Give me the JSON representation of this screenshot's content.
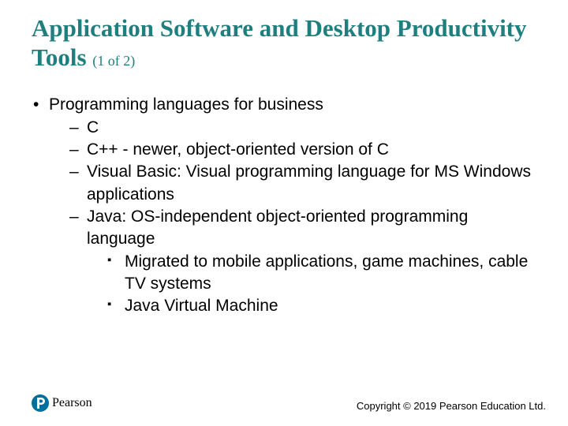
{
  "title": {
    "main": "Application Software and Desktop Productivity Tools",
    "counter": "(1 of 2)"
  },
  "body": {
    "heading": "Programming languages for business",
    "items": [
      {
        "text": "C"
      },
      {
        "text": "C++ - newer, object-oriented version of C"
      },
      {
        "text": "Visual Basic: Visual programming language for MS Windows applications"
      },
      {
        "text": "Java: OS-independent object-oriented programming language",
        "sub": [
          "Migrated to mobile applications, game machines, cable TV systems",
          "Java Virtual Machine"
        ]
      }
    ]
  },
  "footer": {
    "brand": "Pearson",
    "copyright": "Copyright © 2019 Pearson Education Ltd."
  }
}
